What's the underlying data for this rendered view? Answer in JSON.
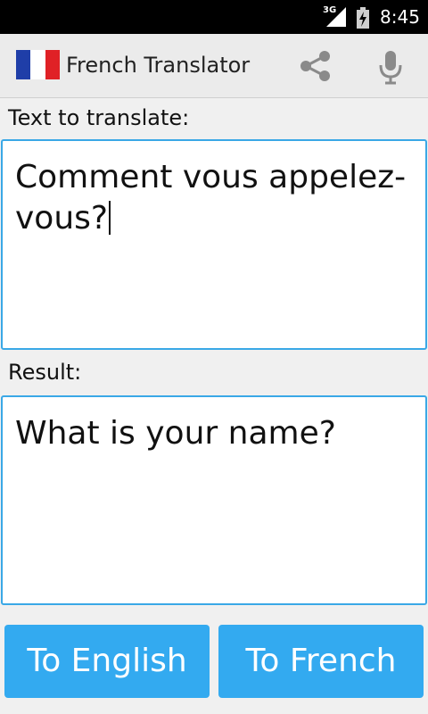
{
  "status_bar": {
    "network": "3G",
    "time": "8:45"
  },
  "action_bar": {
    "title": "French Translator",
    "icons": [
      "france-flag-icon",
      "share-icon",
      "microphone-icon"
    ]
  },
  "input": {
    "label": "Text to translate:",
    "value": "Comment vous appelez-vous?"
  },
  "result": {
    "label": "Result:",
    "value": "What is your name?"
  },
  "buttons": {
    "to_english": "To English",
    "to_french": "To French"
  },
  "colors": {
    "accent": "#33aaf0",
    "border": "#3aa8e6",
    "flag_blue": "#1f3ea8",
    "flag_white": "#ffffff",
    "flag_red": "#e02126"
  }
}
